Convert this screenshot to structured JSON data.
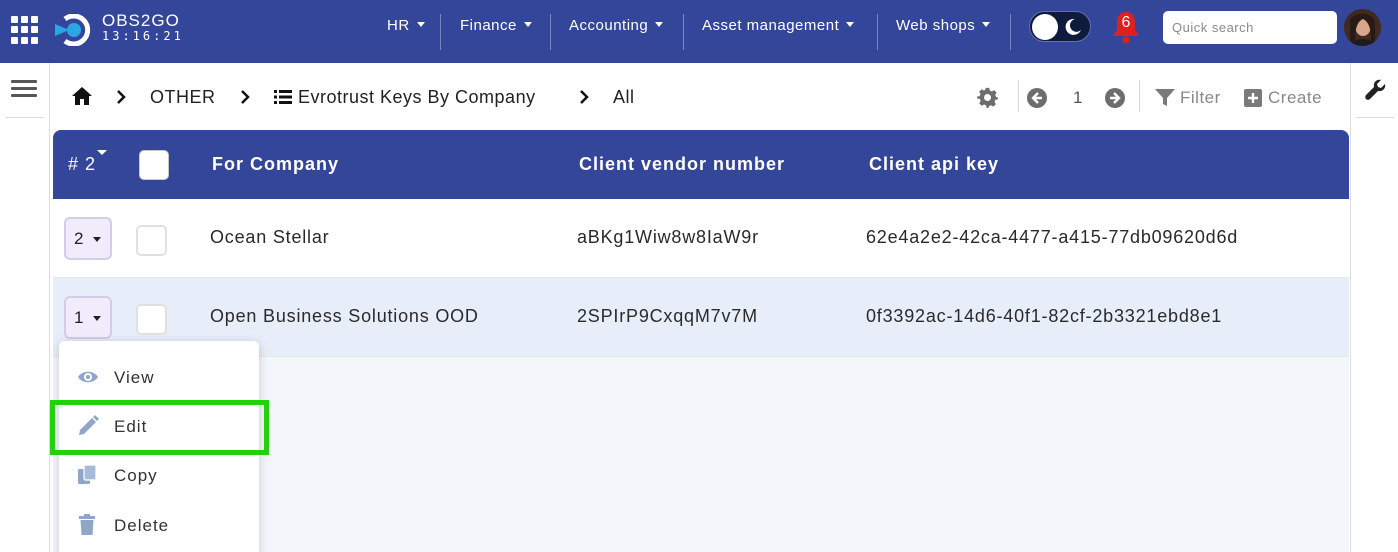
{
  "app": {
    "brand_name": "OBS2GO",
    "clock": "13:16:21"
  },
  "nav": {
    "menus": [
      {
        "label": "HR"
      },
      {
        "label": "Finance"
      },
      {
        "label": "Accounting"
      },
      {
        "label": "Asset management"
      },
      {
        "label": "Web shops"
      }
    ],
    "notifications_count": "6",
    "search_placeholder": "Quick search"
  },
  "breadcrumb": {
    "items": [
      "OTHER",
      "Evrotrust Keys By Company",
      "All"
    ]
  },
  "toolbar": {
    "page_number": "1",
    "filter_label": "Filter",
    "create_label": "Create"
  },
  "table": {
    "headers": {
      "number": "# 2",
      "for_company": "For Company",
      "client_vendor_number": "Client vendor number",
      "client_api_key": "Client api key"
    },
    "rows": [
      {
        "num": "2",
        "for_company": "Ocean Stellar",
        "client_vendor_number": "aBKg1Wiw8w8IaW9r",
        "client_api_key": "62e4a2e2-42ca-4477-a415-77db09620d6d"
      },
      {
        "num": "1",
        "for_company": "Open Business Solutions OOD",
        "client_vendor_number": "2SPIrP9CxqqM7v7M",
        "client_api_key": "0f3392ac-14d6-40f1-82cf-2b3321ebd8e1"
      }
    ]
  },
  "row_menu": {
    "items": [
      {
        "label": "View",
        "icon": "eye-icon"
      },
      {
        "label": "Edit",
        "icon": "pencil-icon"
      },
      {
        "label": "Copy",
        "icon": "copy-icon"
      },
      {
        "label": "Delete",
        "icon": "trash-icon"
      }
    ]
  },
  "colors": {
    "primary": "#33469a",
    "highlight": "#22d10a",
    "selected_row": "#e7eef9",
    "notification": "#e0201f"
  }
}
